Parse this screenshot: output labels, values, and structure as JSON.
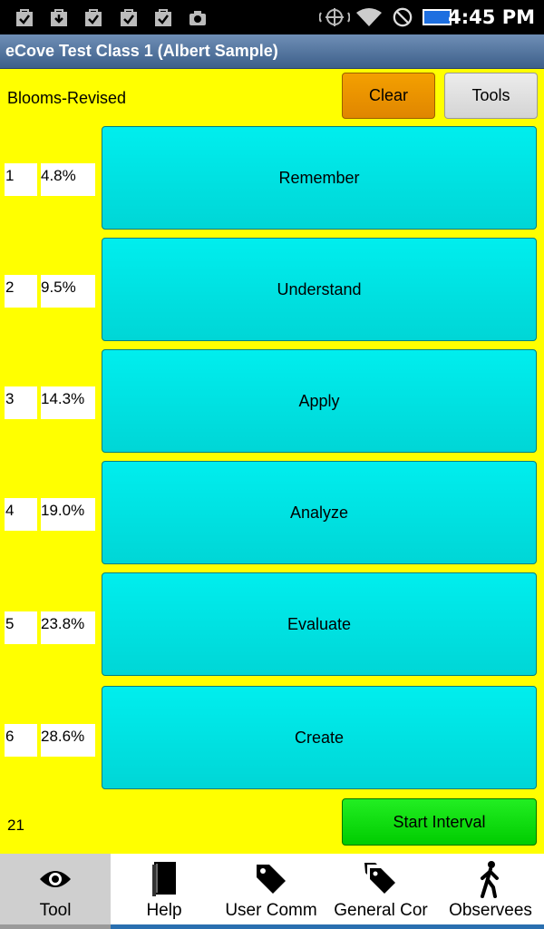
{
  "status_bar": {
    "time": "4:45 PM",
    "left_icons": [
      "check-bag-icon",
      "download-bag-icon",
      "check-bag-icon",
      "check-bag-icon",
      "check-bag-icon",
      "camera-icon"
    ],
    "right_icons": [
      "location-icon",
      "wifi-icon",
      "block-icon",
      "battery-icon"
    ]
  },
  "title_bar": {
    "title": "eCove Test Class 1 (Albert Sample)"
  },
  "toolbar": {
    "label": "Blooms-Revised",
    "clear_label": "Clear",
    "tools_label": "Tools"
  },
  "categories": [
    {
      "num": "1",
      "pct": "4.8%",
      "label": "Remember"
    },
    {
      "num": "2",
      "pct": "9.5%",
      "label": "Understand"
    },
    {
      "num": "3",
      "pct": "14.3%",
      "label": "Apply"
    },
    {
      "num": "4",
      "pct": "19.0%",
      "label": "Analyze"
    },
    {
      "num": "5",
      "pct": "23.8%",
      "label": "Evaluate"
    },
    {
      "num": "6",
      "pct": "28.6%",
      "label": "Create"
    }
  ],
  "footer": {
    "count": "21",
    "start_label": "Start Interval"
  },
  "bottom_nav": [
    {
      "label": "Tool",
      "icon": "eye-icon",
      "active": true
    },
    {
      "label": "Help",
      "icon": "book-icon",
      "active": false
    },
    {
      "label": "User Comm",
      "icon": "tag-icon",
      "active": false
    },
    {
      "label": "General Cor",
      "icon": "tags-icon",
      "active": false
    },
    {
      "label": "Observees",
      "icon": "walking-person-icon",
      "active": false
    }
  ],
  "colors": {
    "background": "#ffff00",
    "category_button": "#00e0e0",
    "clear_button": "#f09000",
    "start_button": "#00dd00",
    "title_bar": "#4f70a0"
  }
}
